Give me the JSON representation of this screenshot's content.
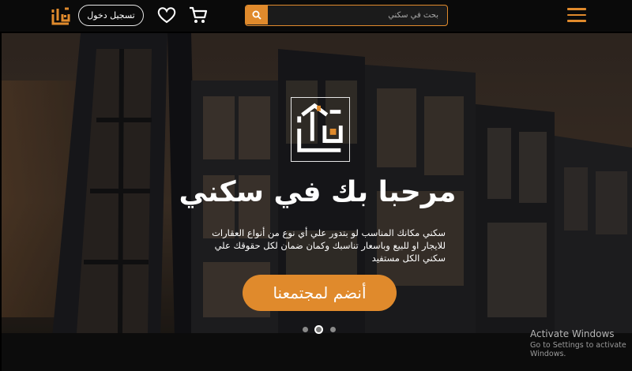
{
  "navbar": {
    "login_label": "تسجيل دخول",
    "search_placeholder": "بحث في سكني",
    "icons": {
      "logo": "sakani-logo-icon",
      "heart": "heart-icon",
      "cart": "cart-icon",
      "search": "search-icon",
      "menu": "hamburger-menu-icon"
    }
  },
  "hero": {
    "title": "مرحبا بك في سكني",
    "description": "سكني مكانك المناسب لو بتدور علي أي نوع من أنواع العقارات للايجار او للبيع وباسعار تناسبك وكمان ضمان لكل حقوقك علي سكني الكل مستفيد",
    "join_label": "أنضم لمجتمعنا",
    "carousel": {
      "count": 3,
      "active": 2
    }
  },
  "watermark": {
    "line1": "Activate Windows",
    "line2": "Go to Settings to activate Windows."
  },
  "colors": {
    "accent": "#e08a2c",
    "navbar_bg": "#0a0a0a",
    "text": "#ffffff"
  }
}
